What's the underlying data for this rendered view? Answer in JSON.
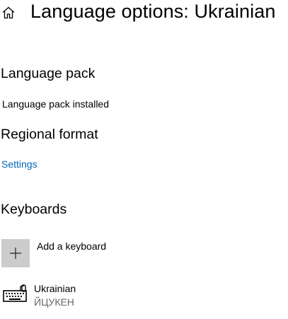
{
  "header": {
    "home_icon": "home-icon",
    "title": "Language options: Ukrainian"
  },
  "language_pack": {
    "heading": "Language pack",
    "status": "Language pack installed"
  },
  "regional_format": {
    "heading": "Regional format",
    "settings_link": "Settings",
    "link_color": "#0067b8"
  },
  "keyboards": {
    "heading": "Keyboards",
    "add_icon": "plus-icon",
    "add_label": "Add a keyboard",
    "items": [
      {
        "icon": "keyboard-icon",
        "name": "Ukrainian",
        "layout": "ЙЦУКЕН"
      }
    ]
  }
}
